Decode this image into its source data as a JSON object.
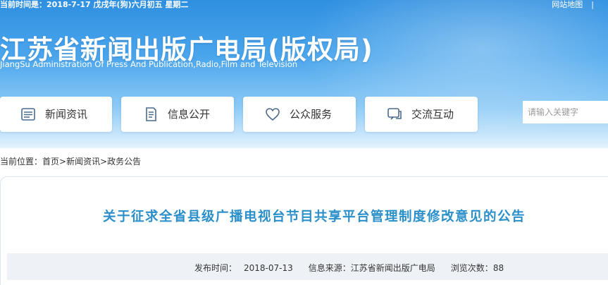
{
  "topbar": {
    "date_text": "当前时间是：2018-7-17 戊戌年(狗)六月初五 星期二",
    "sitemap_label": "网站地图",
    "separator": "|"
  },
  "header": {
    "title": "江苏省新闻出版广电局(版权局)",
    "subtitle": "JiangSu Administration Of Press And Publication,Radio,Film and Television"
  },
  "nav": {
    "items": [
      {
        "label": "新闻资讯",
        "icon": "news-icon"
      },
      {
        "label": "信息公开",
        "icon": "document-icon"
      },
      {
        "label": "公众服务",
        "icon": "heart-icon"
      },
      {
        "label": "交流互动",
        "icon": "chat-icon"
      }
    ]
  },
  "search": {
    "placeholder": "请输入关键字"
  },
  "breadcrumb": {
    "prefix": "当前位置：",
    "items": [
      "首页",
      "新闻资讯",
      "政务公告"
    ],
    "separator": ">"
  },
  "article": {
    "title": "关于征求全省县级广播电视台节目共享平台管理制度修改意见的公告",
    "publish_label": "发布时间：",
    "publish_date": "2018-07-13",
    "source_label": "信息来源：",
    "source_value": "江苏省新闻出版广电局",
    "views_label": "浏览次数：",
    "views_value": "88"
  },
  "colors": {
    "header_blue": "#3a98e6",
    "title_blue": "#2b8fc9",
    "meta_bg": "#eef2f6"
  }
}
